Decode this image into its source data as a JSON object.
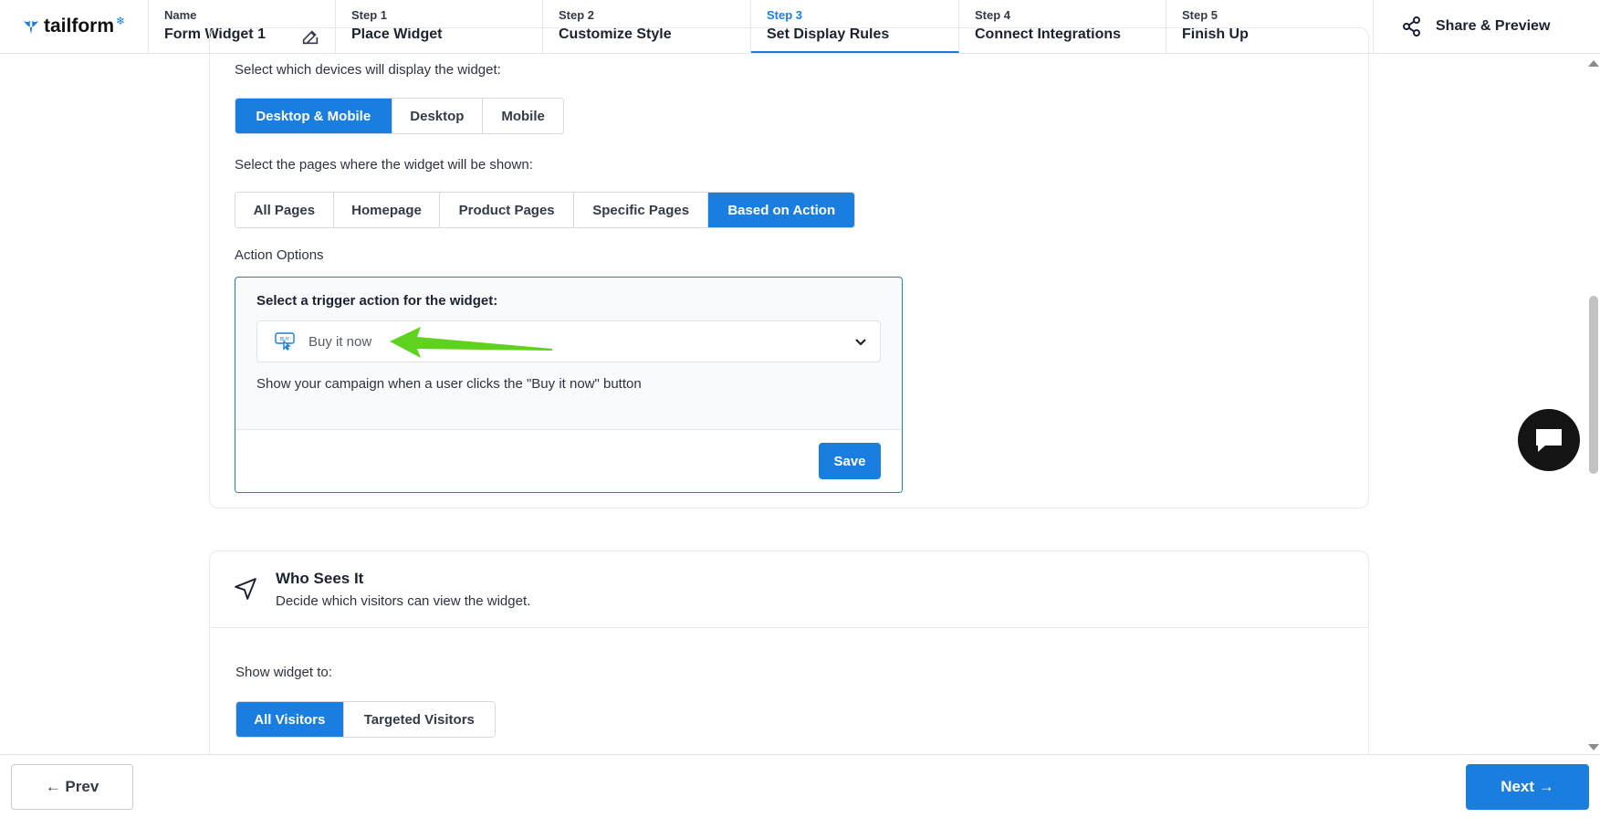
{
  "header": {
    "brand": "tailform",
    "name_label": "Name",
    "name_value": "Form Widget 1",
    "steps": [
      {
        "step": "Step 1",
        "title": "Place Widget"
      },
      {
        "step": "Step 2",
        "title": "Customize Style"
      },
      {
        "step": "Step 3",
        "title": "Set Display Rules",
        "active": true
      },
      {
        "step": "Step 4",
        "title": "Connect Integrations"
      },
      {
        "step": "Step 5",
        "title": "Finish Up"
      }
    ],
    "share_label": "Share & Preview"
  },
  "where": {
    "devices_prompt": "Select which devices will display the widget:",
    "devices": [
      "Desktop & Mobile",
      "Desktop",
      "Mobile"
    ],
    "devices_selected": "Desktop & Mobile",
    "pages_prompt": "Select the pages where the widget will be shown:",
    "pages": [
      "All Pages",
      "Homepage",
      "Product Pages",
      "Specific Pages",
      "Based on Action"
    ],
    "pages_selected": "Based on Action",
    "action_options_label": "Action Options",
    "action": {
      "title": "Select a trigger action for the widget:",
      "selected": "Buy it now",
      "description": "Show your campaign when a user clicks the \"Buy it now\" button",
      "save_label": "Save"
    }
  },
  "who": {
    "title": "Who Sees It",
    "subtitle": "Decide which visitors can view the widget.",
    "show_prompt": "Show widget to:",
    "options": [
      "All Visitors",
      "Targeted Visitors"
    ],
    "selected": "All Visitors"
  },
  "footer": {
    "prev_label": "← Prev",
    "next_label": "Next →"
  },
  "colors": {
    "accent": "#1a7ee0",
    "annotation_arrow": "#5fd21e"
  },
  "icons": {
    "logo": "tail-logo-icon",
    "edit": "edit-icon",
    "share": "share-icon",
    "buy": "buy-button-icon",
    "chevron": "chevron-down-icon",
    "who": "navigation-arrow-icon",
    "chat": "chat-icon"
  }
}
